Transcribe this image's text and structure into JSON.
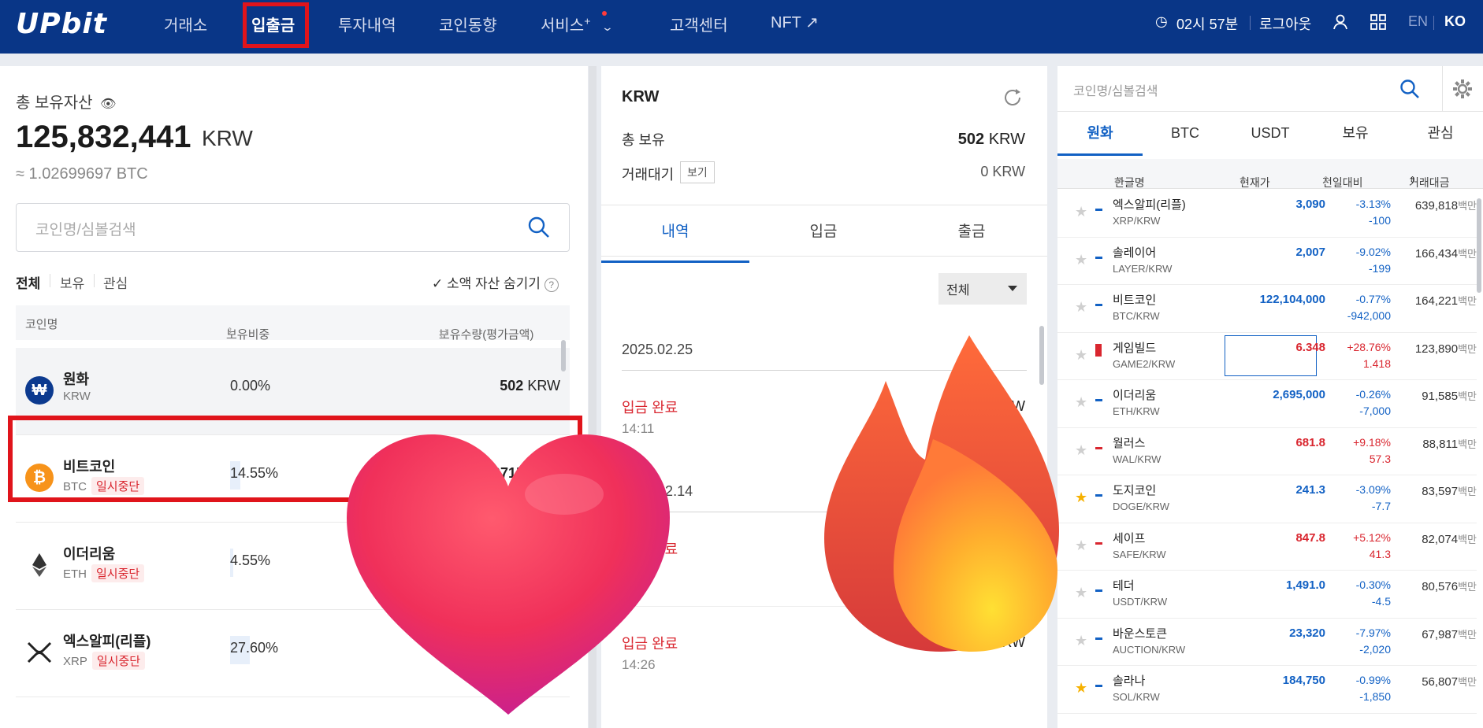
{
  "nav": {
    "logo": "UPbit",
    "items": [
      "거래소",
      "입출금",
      "투자내역",
      "코인동향",
      "서비스",
      "고객센터",
      "NFT ↗"
    ],
    "service_plus": "+",
    "time": "02시 57분",
    "logout": "로그아웃",
    "lang_en": "EN",
    "lang_ko": "KO"
  },
  "left": {
    "title": "총 보유자산",
    "total_value": "125,832,441",
    "total_unit": "KRW",
    "btc_equiv": "≈ 1.02699697 BTC",
    "search_placeholder": "코인명/심볼검색",
    "tabs": [
      "전체",
      "보유",
      "관심"
    ],
    "hide_small": "소액 자산 숨기기",
    "columns": [
      "코인명",
      "보유비중",
      "보유수량(평가금액)"
    ],
    "suspend_label": "일시중단",
    "rows": [
      {
        "name": "원화",
        "symbol": "KRW",
        "pct": "0.00%",
        "pct_value": 0.0,
        "amount": "502",
        "unit": "KRW"
      },
      {
        "name": "비트코인",
        "symbol": "BTC",
        "pct": "14.55%",
        "pct_value": 14.55,
        "amount": "0.0715…"
      },
      {
        "name": "이더리움",
        "symbol": "ETH",
        "pct": "4.55%",
        "pct_value": 4.55,
        "amount": ""
      },
      {
        "name": "엑스알피(리플)",
        "symbol": "XRP",
        "pct": "27.60%",
        "pct_value": 27.6,
        "amount": ""
      }
    ]
  },
  "mid": {
    "currency": "KRW",
    "total_label": "총 보유",
    "total_amount": "502",
    "total_unit": "KRW",
    "pending_label": "거래대기",
    "view_button": "보기",
    "pending_value": "0 KRW",
    "tabs": [
      "내역",
      "입금",
      "출금"
    ],
    "filter": "전체",
    "entries": [
      {
        "date": "2025.02.25",
        "status": "입금 완료",
        "time": "14:11",
        "amount": "W"
      },
      {
        "date": "2025.02.14",
        "status": "입금 완료",
        "time": "",
        "amount": ""
      },
      {
        "date": "",
        "status": "입금 완료",
        "time": "14:26",
        "amount": "KRW"
      }
    ]
  },
  "right": {
    "search_placeholder": "코인명/심볼검색",
    "tabs": [
      "원화",
      "BTC",
      "USDT",
      "보유",
      "관심"
    ],
    "columns": [
      "한글명",
      "현재가",
      "전일대비",
      "거래대금"
    ],
    "vol_unit": "백만",
    "rows": [
      {
        "name": "엑스알피(리플)",
        "pair": "XRP/KRW",
        "price": "3,090",
        "change": "-3.13%",
        "change_abs": "-100",
        "volume": "639,818",
        "dir": "down",
        "star": false
      },
      {
        "name": "솔레이어",
        "pair": "LAYER/KRW",
        "price": "2,007",
        "change": "-9.02%",
        "change_abs": "-199",
        "volume": "166,434",
        "dir": "down",
        "star": false
      },
      {
        "name": "비트코인",
        "pair": "BTC/KRW",
        "price": "122,104,000",
        "change": "-0.77%",
        "change_abs": "-942,000",
        "volume": "164,221",
        "dir": "down",
        "star": false
      },
      {
        "name": "게임빌드",
        "pair": "GAME2/KRW",
        "price": "6.348",
        "change": "+28.76%",
        "change_abs": "1.418",
        "volume": "123,890",
        "dir": "up",
        "star": false
      },
      {
        "name": "이더리움",
        "pair": "ETH/KRW",
        "price": "2,695,000",
        "change": "-0.26%",
        "change_abs": "-7,000",
        "volume": "91,585",
        "dir": "down",
        "star": false
      },
      {
        "name": "월러스",
        "pair": "WAL/KRW",
        "price": "681.8",
        "change": "+9.18%",
        "change_abs": "57.3",
        "volume": "88,811",
        "dir": "up",
        "star": false
      },
      {
        "name": "도지코인",
        "pair": "DOGE/KRW",
        "price": "241.3",
        "change": "-3.09%",
        "change_abs": "-7.7",
        "volume": "83,597",
        "dir": "down",
        "star": true
      },
      {
        "name": "세이프",
        "pair": "SAFE/KRW",
        "price": "847.8",
        "change": "+5.12%",
        "change_abs": "41.3",
        "volume": "82,074",
        "dir": "up",
        "star": false
      },
      {
        "name": "테더",
        "pair": "USDT/KRW",
        "price": "1,491.0",
        "change": "-0.30%",
        "change_abs": "-4.5",
        "volume": "80,576",
        "dir": "down",
        "star": false
      },
      {
        "name": "바운스토큰",
        "pair": "AUCTION/KRW",
        "price": "23,320",
        "change": "-7.97%",
        "change_abs": "-2,020",
        "volume": "67,987",
        "dir": "down",
        "star": false
      },
      {
        "name": "솔라나",
        "pair": "SOL/KRW",
        "price": "184,750",
        "change": "-0.99%",
        "change_abs": "-1,850",
        "volume": "56,807",
        "dir": "down",
        "star": true
      }
    ]
  },
  "colors": {
    "nav_bg": "#093687",
    "up": "#d9262f",
    "down": "#1261c4",
    "highlight": "#e0141b"
  }
}
